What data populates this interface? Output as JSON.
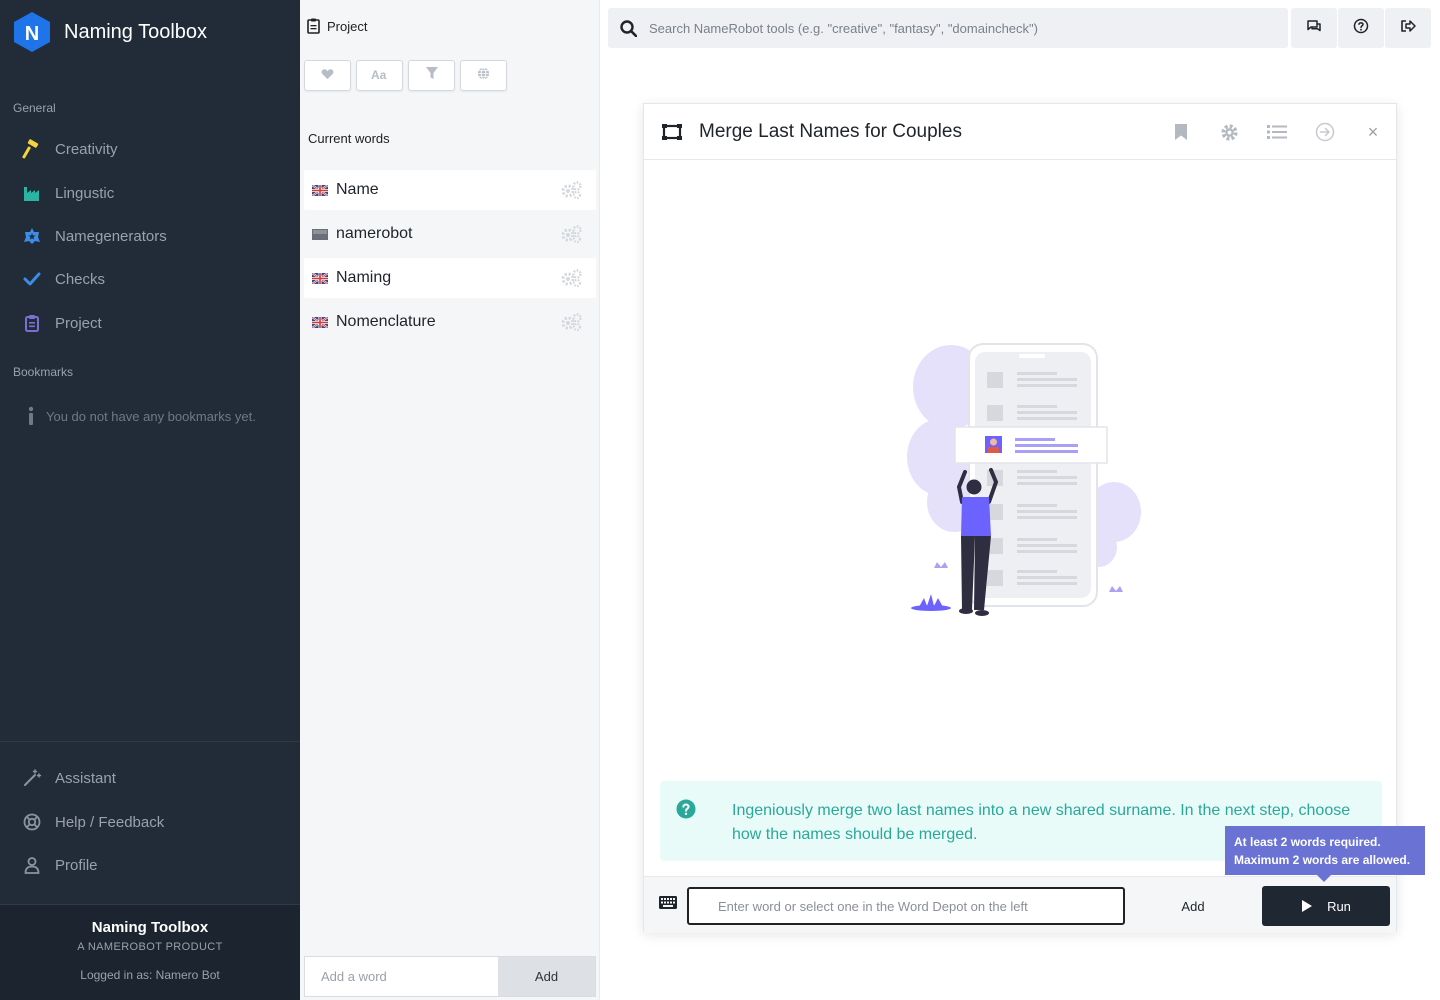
{
  "colors": {
    "sidebar_bg": "#222b38",
    "brand_blue": "#1e74e8",
    "accent_teal": "#2aa89a",
    "tooltip_purple": "#6a72d4",
    "run_button": "#1f2733"
  },
  "sidebar": {
    "app_title": "Naming Toolbox",
    "general_title": "General",
    "items": [
      {
        "label": "Creativity",
        "icon": "hammer-icon",
        "color": "#f5d33a"
      },
      {
        "label": "Lingustic",
        "icon": "factory-icon",
        "color": "#2bb3a3"
      },
      {
        "label": "Namegenerators",
        "icon": "star-badge-icon",
        "color": "#3d8ce8"
      },
      {
        "label": "Checks",
        "icon": "check-icon",
        "color": "#3d8ce8"
      },
      {
        "label": "Project",
        "icon": "clipboard-icon",
        "color": "#7b6fd6"
      }
    ],
    "bookmarks_title": "Bookmarks",
    "bookmarks_empty": "You do not have any bookmarks yet.",
    "bottom_items": [
      {
        "label": "Assistant",
        "icon": "magic-wand-icon"
      },
      {
        "label": "Help / Feedback",
        "icon": "lifebuoy-icon"
      },
      {
        "label": "Profile",
        "icon": "user-icon"
      }
    ],
    "footer": {
      "title": "Naming Toolbox",
      "subtitle": "A NAMEROBOT PRODUCT",
      "logged_in": "Logged in as: Namero Bot"
    }
  },
  "project_panel": {
    "title": "Project",
    "filters": [
      "heart-icon",
      "font-case-icon",
      "filter-icon",
      "globe-icon"
    ],
    "current_words_title": "Current words",
    "words": [
      {
        "text": "Name",
        "flag": "uk-flag-icon",
        "highlight": true
      },
      {
        "text": "namerobot",
        "flag": "neutral-flag-icon",
        "highlight": false
      },
      {
        "text": "Naming",
        "flag": "uk-flag-icon",
        "highlight": true
      },
      {
        "text": "Nomenclature",
        "flag": "uk-flag-icon",
        "highlight": false
      }
    ],
    "add_word_placeholder": "Add a word",
    "add_button": "Add"
  },
  "topbar": {
    "search_placeholder": "Search NameRobot tools (e.g. \"creative\", \"fantasy\", \"domaincheck\")",
    "buttons": [
      "chat-icon",
      "help-circle-icon",
      "logout-icon"
    ]
  },
  "tool": {
    "title": "Merge Last Names for Couples",
    "header_icons": [
      "bookmark-icon",
      "gear-icon",
      "list-icon",
      "arrow-circle-right-icon",
      "close-icon"
    ],
    "close_label": "×",
    "info_text": "Ingeniously merge two last names into a new shared surname. In the next step, choose how the names should be merged.",
    "tooltip_line1": "At least 2 words required.",
    "tooltip_line2": "Maximum 2 words are allowed.",
    "input_placeholder": "Enter word or select one in the Word Depot on the left",
    "add_button": "Add",
    "run_button": "Run"
  }
}
